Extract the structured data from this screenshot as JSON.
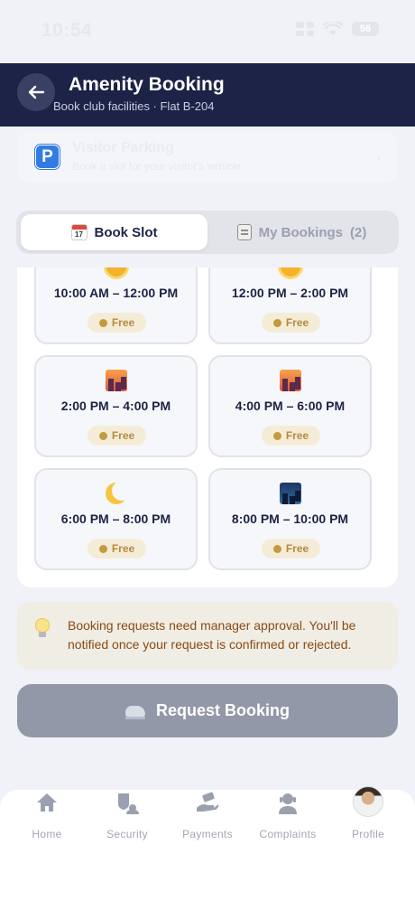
{
  "status_bar": {
    "time": "10:54",
    "battery": "56"
  },
  "header": {
    "title": "Amenity Booking",
    "subtitle": "Book club facilities · Flat B-204"
  },
  "parking": {
    "title": "Visitor Parking",
    "subtitle": "Book a slot for your visitor's vehicle"
  },
  "tabs": [
    {
      "label": "Book Slot",
      "active": true
    },
    {
      "label": "My Bookings",
      "count": "(2)",
      "active": false
    }
  ],
  "slots": [
    {
      "time": "10:00 AM – 12:00 PM",
      "status": "Free",
      "icon": "sun-icon"
    },
    {
      "time": "12:00 PM – 2:00 PM",
      "status": "Free",
      "icon": "sun-face-icon"
    },
    {
      "time": "2:00 PM – 4:00 PM",
      "status": "Free",
      "icon": "city-sunset-icon"
    },
    {
      "time": "4:00 PM – 6:00 PM",
      "status": "Free",
      "icon": "city-dusk-icon"
    },
    {
      "time": "6:00 PM – 8:00 PM",
      "status": "Free",
      "icon": "crescent-moon-icon"
    },
    {
      "time": "8:00 PM – 10:00 PM",
      "status": "Free",
      "icon": "night-city-icon"
    }
  ],
  "info": {
    "text": "Booking requests need manager approval. You'll be notified once your request is confirmed or rejected."
  },
  "request_button": {
    "label": "Request Booking"
  },
  "nav": [
    {
      "label": "Home",
      "icon": "home-icon"
    },
    {
      "label": "Security",
      "icon": "security-icon"
    },
    {
      "label": "Payments",
      "icon": "payments-icon"
    },
    {
      "label": "Complaints",
      "icon": "complaints-icon"
    },
    {
      "label": "Profile",
      "icon": "avatar"
    }
  ],
  "colors": {
    "header_bg": "#1c2346",
    "badge_bg": "#f5ecd8",
    "badge_text": "#b58a3e",
    "button_disabled": "#9398a8"
  }
}
